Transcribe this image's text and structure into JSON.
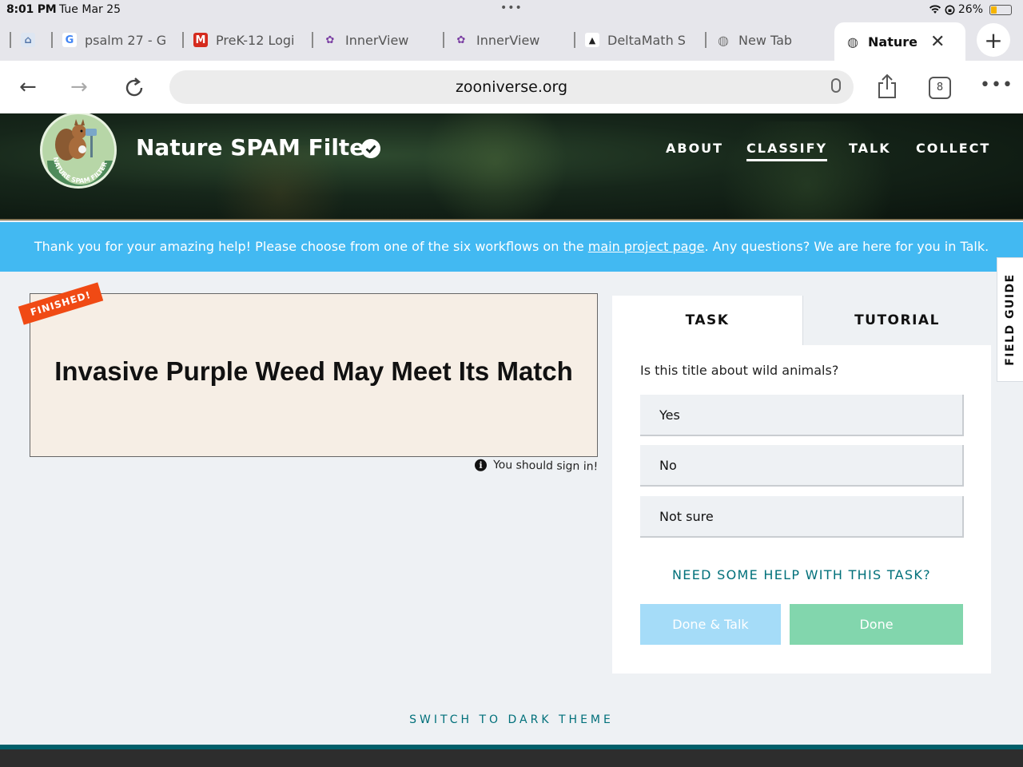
{
  "status_bar": {
    "time": "8:01 PM",
    "date": "Tue Mar 25",
    "battery": "26%"
  },
  "tabs": [
    {
      "label": "",
      "icon": "app-icon"
    },
    {
      "label": "psalm 27 - G",
      "icon": "google-icon"
    },
    {
      "label": "PreK-12 Logi",
      "icon": "mcgraw-icon"
    },
    {
      "label": "InnerView",
      "icon": "innerview-icon"
    },
    {
      "label": "InnerView",
      "icon": "innerview-icon"
    },
    {
      "label": "DeltaMath S",
      "icon": "deltamath-icon"
    },
    {
      "label": "New Tab",
      "icon": "globe-icon"
    },
    {
      "label": "Nature S",
      "icon": "globe-icon",
      "active": true
    }
  ],
  "address_bar": {
    "url": "zooniverse.org",
    "tab_count": "8"
  },
  "project": {
    "title": "Nature SPAM Filter",
    "logo_text": "NATURE SPAM FILTER"
  },
  "nav": {
    "about": "ABOUT",
    "classify": "CLASSIFY",
    "talk": "TALK",
    "collect": "COLLECT"
  },
  "banner": {
    "text_before": "Thank you for your amazing help! Please choose from one of the six workflows on the ",
    "link": "main project page",
    "text_after": ". Any questions? We are here for you in Talk."
  },
  "subject": {
    "ribbon": "FINISHED!",
    "title": "Invasive Purple Weed May Meet Its Match",
    "sign_in_note": "You should sign in!"
  },
  "task_panel": {
    "tab_task": "TASK",
    "tab_tutorial": "TUTORIAL",
    "question": "Is this title about wild animals?",
    "answers": [
      "Yes",
      "No",
      "Not sure"
    ],
    "help": "NEED SOME HELP WITH THIS TASK?",
    "done_talk": "Done & Talk",
    "done": "Done"
  },
  "field_guide": "FIELD GUIDE",
  "dark_theme": "SWITCH TO DARK THEME",
  "colors": {
    "banner": "#42b9f2",
    "ribbon": "#f04a14",
    "done": "#82d6ad",
    "done_talk": "#a5dcf8",
    "teal": "#00707a"
  }
}
